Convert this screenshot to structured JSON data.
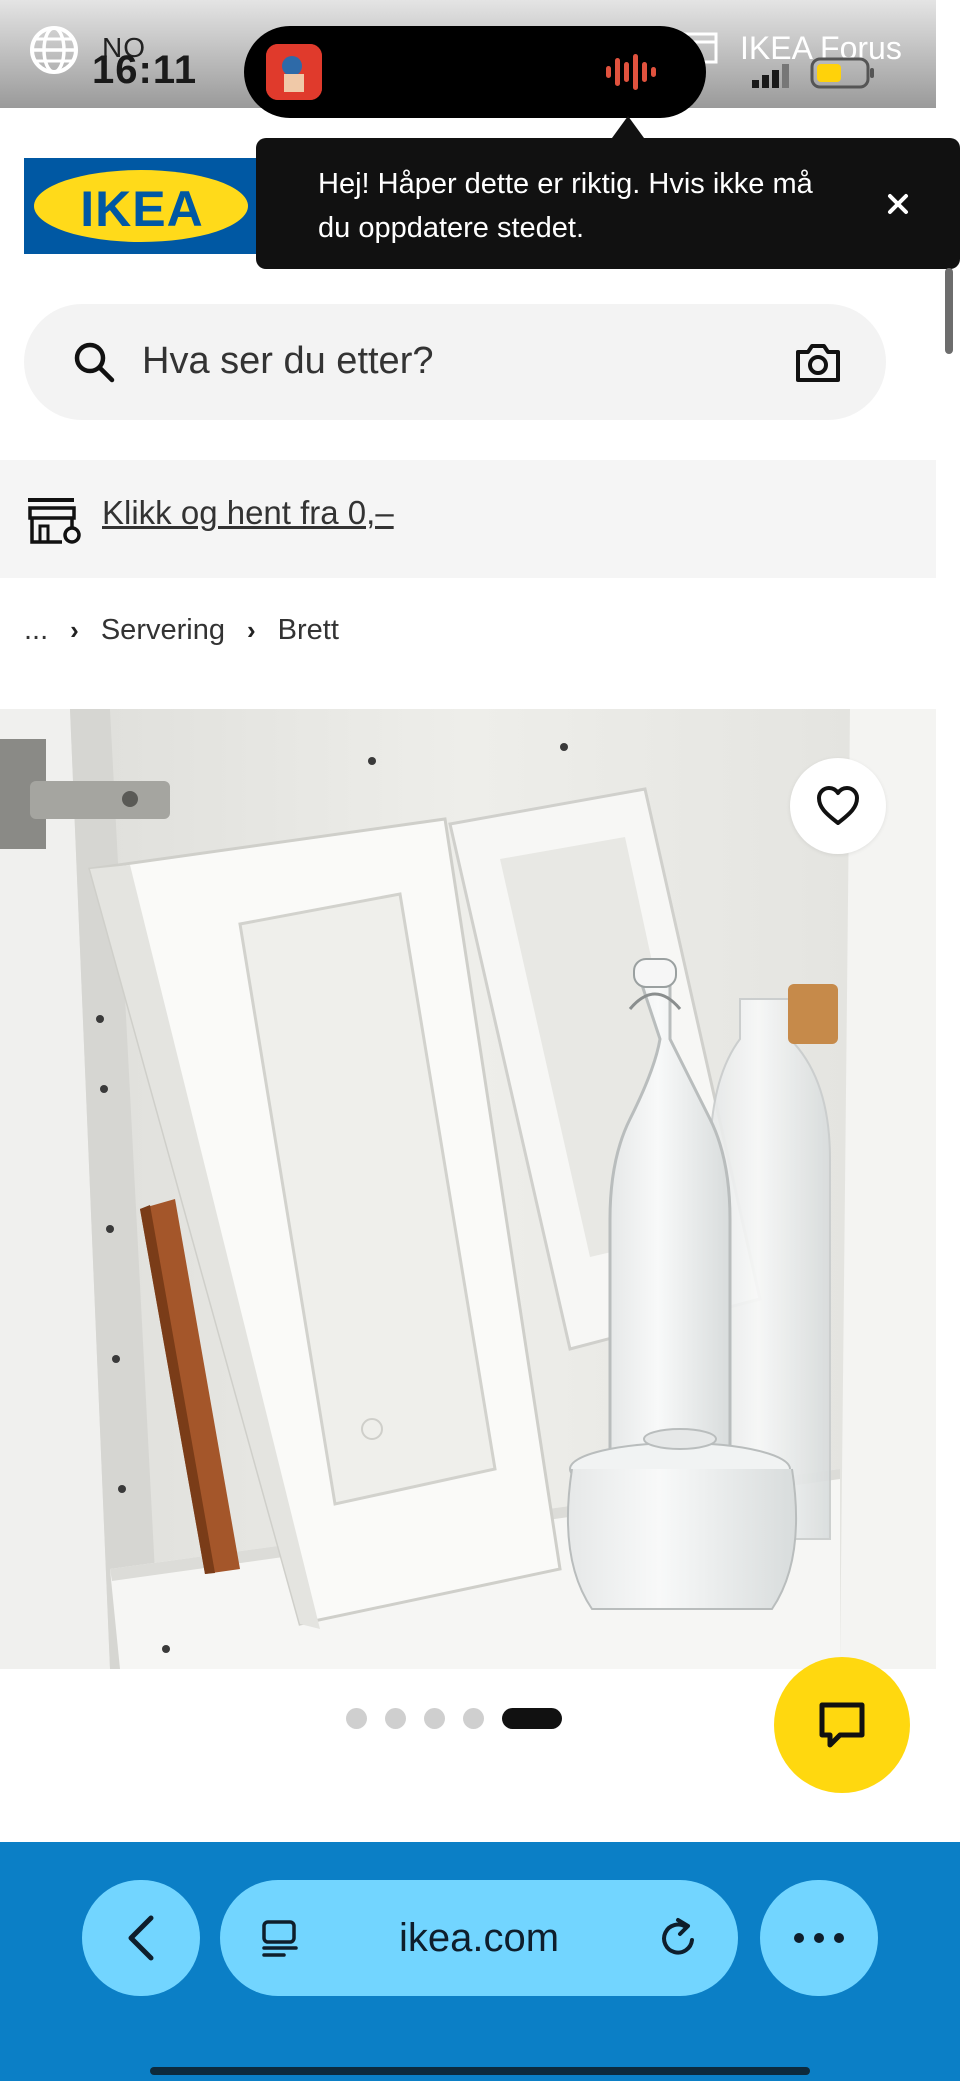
{
  "status_bar": {
    "locale": "NO",
    "time": "16:11",
    "store_name": "IKEA Forus"
  },
  "tooltip": {
    "message": "Hej! Håper dette er riktig. Hvis ikke må du oppdatere stedet."
  },
  "header": {
    "logo_text": "IKEA"
  },
  "search": {
    "placeholder": "Hva ser du etter?"
  },
  "promo": {
    "text": "Klikk og hent fra 0,–"
  },
  "breadcrumb": {
    "ellipsis": "...",
    "items": [
      "Servering",
      "Brett"
    ]
  },
  "gallery": {
    "dot_count": 5,
    "active_index": 4
  },
  "browser": {
    "url": "ikea.com"
  },
  "colors": {
    "ikea_blue": "#0058a3",
    "ikea_yellow": "#ffda1a",
    "chat_yellow": "#ffd80f",
    "browser_blue": "#0b7fc6",
    "pill_blue": "#72d5ff"
  }
}
